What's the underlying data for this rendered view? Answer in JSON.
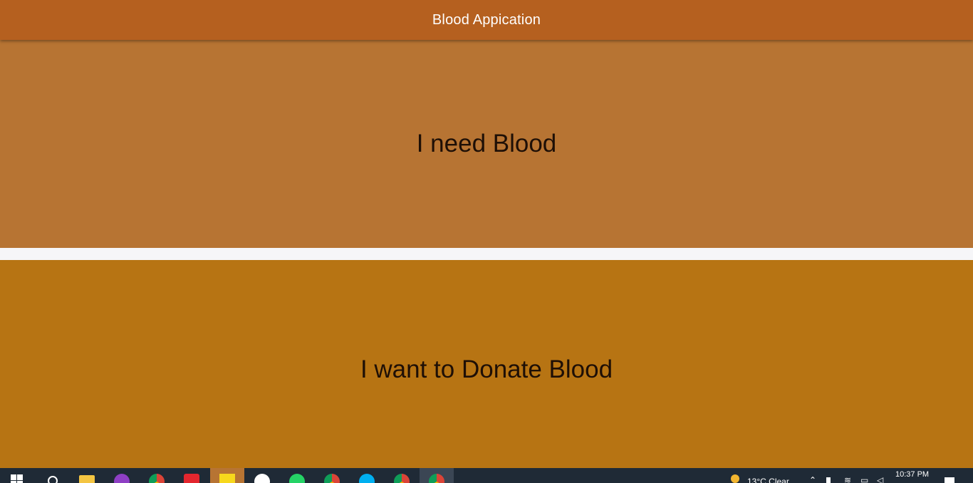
{
  "app": {
    "title": "Blood Appication"
  },
  "options": {
    "need_label": "I need Blood",
    "donate_label": "I want to Donate Blood"
  },
  "colors": {
    "appbar": "#b5601f",
    "need_card": "#b77433",
    "donate_card": "#b77413",
    "label_text": "#1e0f06",
    "taskbar": "#1f2a36"
  },
  "taskbar": {
    "apps": [
      "file-explorer-icon",
      "podcast-icon",
      "chrome-icon",
      "vivaldi-icon",
      "sticky-notes-icon",
      "paint-icon",
      "whatsapp-icon",
      "chrome-icon",
      "skype-icon",
      "chrome-icon",
      "chrome-icon"
    ],
    "weather": "13°C  Clear",
    "time": "10:37 PM"
  }
}
